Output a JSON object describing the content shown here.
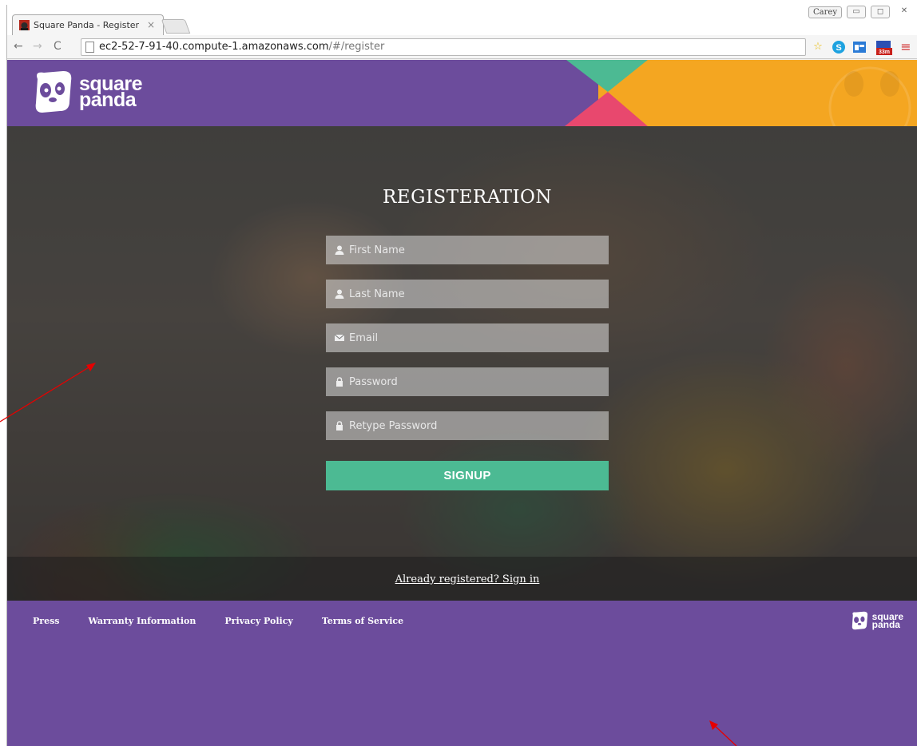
{
  "browser": {
    "tab_title": "Square Panda - Register",
    "tab_close": "×",
    "user_badge": "Carey",
    "url_host": "ec2-52-7-91-40.compute-1.amazonaws.com",
    "url_path": "/#/register",
    "extension_badge": "33m"
  },
  "header": {
    "logo_line1": "square",
    "logo_line2": "panda"
  },
  "form": {
    "title": "REGISTERATION",
    "first_name_placeholder": "First Name",
    "last_name_placeholder": "Last Name",
    "email_placeholder": "Email",
    "password_placeholder": "Password",
    "retype_password_placeholder": "Retype Password",
    "signup_label": "SIGNUP"
  },
  "signin": {
    "link_text": "Already registered? Sign in"
  },
  "footer": {
    "links": [
      "Press",
      "Warranty Information",
      "Privacy Policy",
      "Terms of Service"
    ],
    "logo_line1": "square",
    "logo_line2": "panda"
  },
  "colors": {
    "brand_purple": "#6c4c9c",
    "brand_orange": "#f4a621",
    "brand_teal": "#4cba93",
    "brand_pink": "#e8486e",
    "annotation_arrow": "#e60000"
  }
}
